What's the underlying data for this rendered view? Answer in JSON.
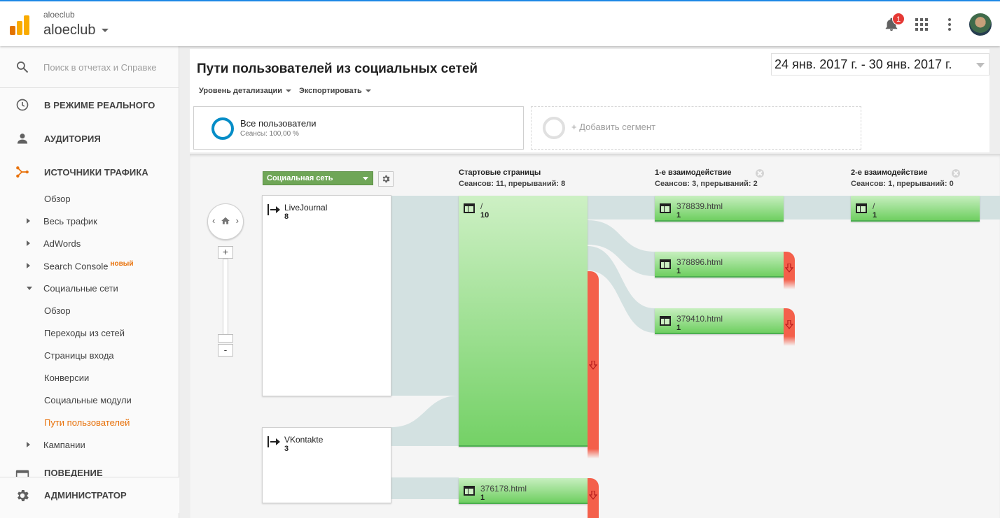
{
  "app": {
    "account_small": "aloeclub",
    "account_name": "aloeclub",
    "notification_count": "1"
  },
  "colors": {
    "accent": "#e8710a",
    "topbar_line": "#1e88e5",
    "segment_ring": "#058dc7",
    "node_green": "#74d166",
    "dropoff_red": "#f4604b",
    "dimension_select": "#6fa657",
    "flow_link": "#d3e1e1"
  },
  "sidebar": {
    "search_placeholder": "Поиск в отчетах и Справке",
    "sections": {
      "realtime": "В РЕЖИМЕ РЕАЛЬНОГО",
      "audience": "АУДИТОРИЯ",
      "traffic": "ИСТОЧНИКИ ТРАФИКА",
      "behavior": "ПОВЕДЕНИЕ",
      "admin": "АДМИНИСТРАТОР"
    },
    "traffic_items": {
      "overview": "Обзор",
      "all_traffic": "Весь трафик",
      "adwords": "AdWords",
      "search_console": "Search Console",
      "search_console_badge": "новый",
      "social": "Социальные сети",
      "campaigns": "Кампании"
    },
    "social_items": {
      "overview": "Обзор",
      "network_referrals": "Переходы из сетей",
      "landing_pages": "Страницы входа",
      "conversions": "Конверсии",
      "plugins": "Социальные модули",
      "users_flow": "Пути пользователей"
    }
  },
  "report": {
    "title": "Пути пользователей из социальных сетей",
    "date_range": "24 янв. 2017 г. - 30 янв. 2017 г.",
    "toolbar": {
      "detail_level": "Уровень детализации",
      "export": "Экспортировать"
    },
    "segments": {
      "all_users": "Все пользователи",
      "all_users_sub": "Сеансы: 100,00 %",
      "add_segment": "+ Добавить сегмент"
    }
  },
  "flow": {
    "dimension": "Социальная сеть",
    "columns": {
      "start": {
        "title": "Стартовые страницы",
        "stats": "Сеансов: 11, прерываний: 8"
      },
      "step1": {
        "title": "1-е взаимодействие",
        "stats": "Сеансов: 3, прерываний: 2"
      },
      "step2": {
        "title": "2-е взаимодействие",
        "stats": "Сеансов: 1, прерываний: 0"
      }
    },
    "zoom": {
      "plus": "+",
      "minus": "-"
    },
    "sources": [
      {
        "name": "LiveJournal",
        "count": "8"
      },
      {
        "name": "VKontakte",
        "count": "3"
      }
    ],
    "start_pages": [
      {
        "name": "/",
        "count": "10"
      },
      {
        "name": "376178.html",
        "count": "1"
      }
    ],
    "step1_pages": [
      {
        "name": "378839.html",
        "count": "1"
      },
      {
        "name": "378896.html",
        "count": "1"
      },
      {
        "name": "379410.html",
        "count": "1"
      }
    ],
    "step2_pages": [
      {
        "name": "/",
        "count": "1"
      }
    ]
  }
}
